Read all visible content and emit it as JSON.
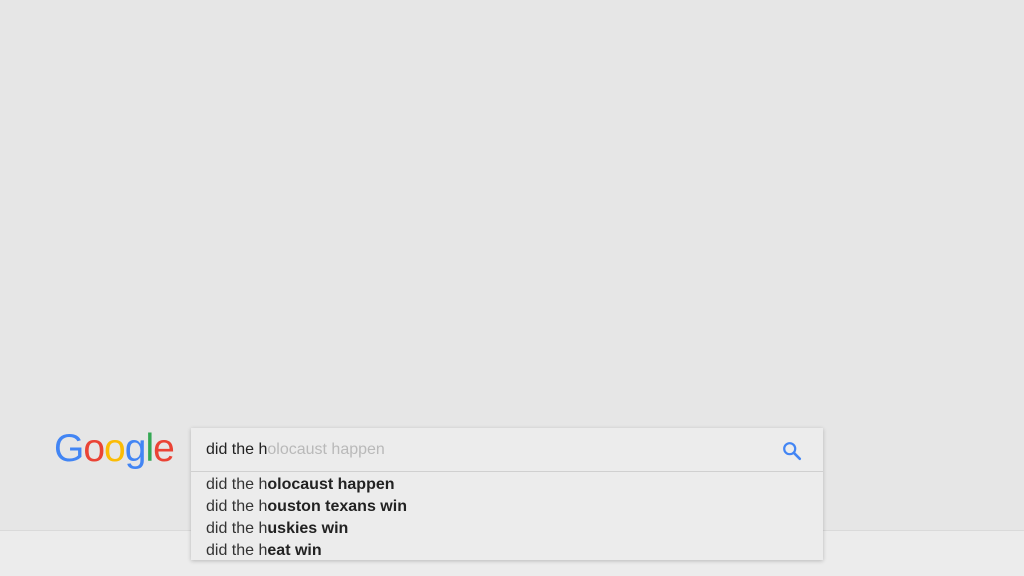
{
  "logo": {
    "letters": [
      "G",
      "o",
      "o",
      "g",
      "l",
      "e"
    ],
    "colors": [
      "#4285F4",
      "#EA4335",
      "#FBBC05",
      "#4285F4",
      "#34A853",
      "#EA4335"
    ]
  },
  "search": {
    "typed": "did the h",
    "completion": "olocaust happen",
    "icon": "search-icon",
    "icon_color": "#4285F4"
  },
  "suggestions": [
    {
      "prefix": "did the h",
      "rest": "olocaust happen"
    },
    {
      "prefix": "did the h",
      "rest": "ouston texans win"
    },
    {
      "prefix": "did the h",
      "rest": "uskies win"
    },
    {
      "prefix": "did the h",
      "rest": "eat win"
    }
  ]
}
